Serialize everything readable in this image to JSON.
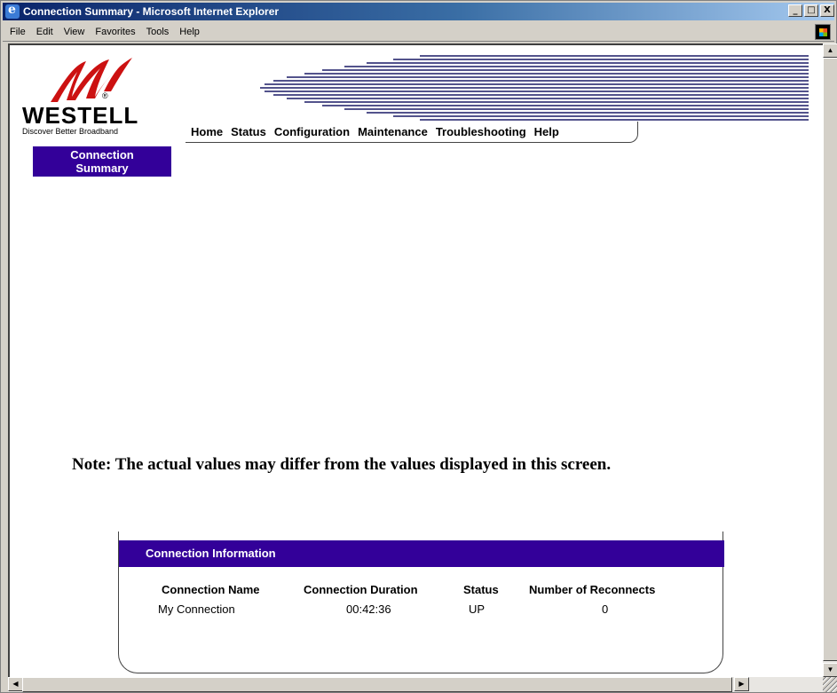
{
  "window": {
    "title": "Connection Summary - Microsoft Internet Explorer",
    "controls": [
      "_",
      "□",
      "X"
    ]
  },
  "menubar": {
    "items": [
      "File",
      "Edit",
      "View",
      "Favorites",
      "Tools",
      "Help"
    ]
  },
  "logo": {
    "brand": "WESTELL",
    "tagline": "Discover Better Broadband",
    "registered": "®"
  },
  "nav": {
    "items": [
      "Home",
      "Status",
      "Configuration",
      "Maintenance",
      "Troubleshooting",
      "Help"
    ]
  },
  "subnav": {
    "label_line1": "Connection",
    "label_line2": "Summary"
  },
  "note": {
    "text": "Note: The actual values may differ from the values displayed in this screen."
  },
  "connection_info": {
    "title": "Connection Information",
    "columns": [
      "Connection Name",
      "Connection Duration",
      "Status",
      "Number of Reconnects"
    ],
    "rows": [
      [
        "My Connection",
        "00:42:36",
        "UP",
        "0"
      ]
    ]
  },
  "colors": {
    "accent_purple": "#330099",
    "title_bar_start": "#0a246a",
    "title_bar_end": "#a6caf0",
    "logo_red": "#cc1111"
  }
}
